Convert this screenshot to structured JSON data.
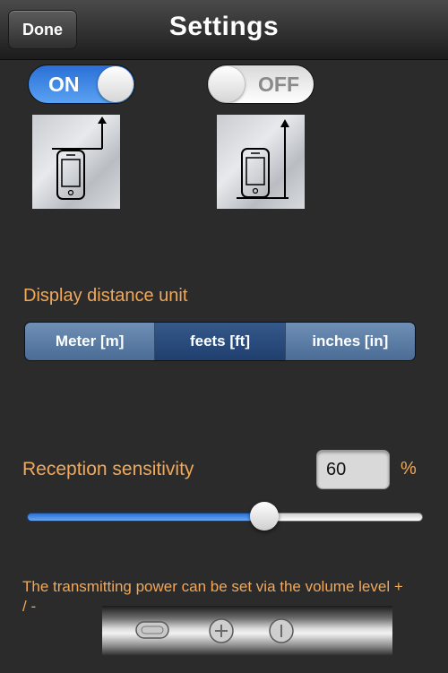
{
  "navbar": {
    "done_label": "Done",
    "title": "Settings"
  },
  "toggles": [
    {
      "label": "ON",
      "state": "on"
    },
    {
      "label": "OFF",
      "state": "off"
    }
  ],
  "icons": {
    "phone_small": "phone-with-short-arrow-icon",
    "phone_tall": "phone-with-tall-arrow-icon"
  },
  "distance": {
    "label": "Display distance unit",
    "options": [
      "Meter [m]",
      "feets [ft]",
      "inches [in]"
    ],
    "selected_index": 1
  },
  "sensitivity": {
    "label": "Reception sensitivity",
    "value": "60",
    "unit": "%",
    "level_percent": 60
  },
  "hint": {
    "text": "The transmitting power can be set via the volume level + / -"
  },
  "colors": {
    "accent": "#f0a85a",
    "toggle_on": "#3b82e6",
    "selected_segment": "#2a4f80"
  }
}
